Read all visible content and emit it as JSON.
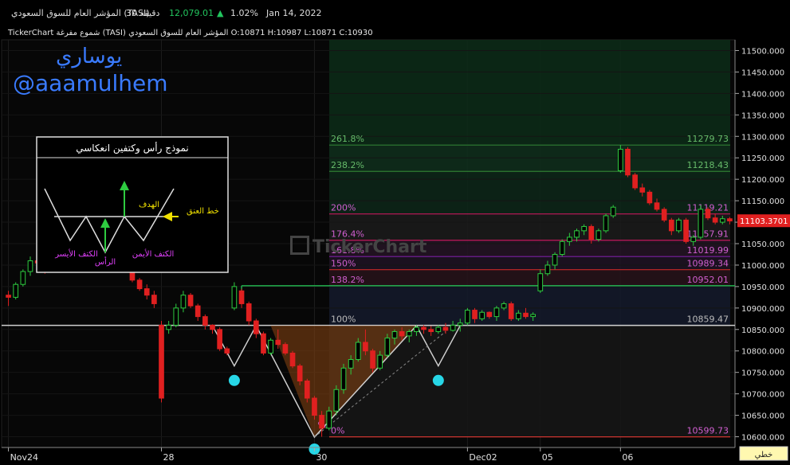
{
  "header": {
    "date": "Jan 14, 2022",
    "change_pct": "1.02%",
    "last_price": "12,079.01",
    "interval": "30 دقيقة",
    "symbol_title": "المؤشر العام للسوق السعودي (TASI)",
    "ohlc_line": "TickerChart شموع مفرغة (TASI) المؤشر العام للسوق السعودي O:10871 H:10987 L:10871 C:10930",
    "up_color": "#22c55e"
  },
  "watermark": {
    "name": "يوساري",
    "handle": "@aaamulhem",
    "brand": "TickerChart"
  },
  "pattern_box": {
    "title": "نموذج رأس وكتفين انعكاسي",
    "target": "الهدف",
    "neckline": "خط العنق",
    "left_shoulder": "الكتف الأيسر",
    "head": "الرأس",
    "right_shoulder": "الكتف الأيمن"
  },
  "bottom_right": {
    "label": "خطي"
  },
  "chart_data": {
    "type": "candlestick",
    "ylim": [
      10575,
      11525
    ],
    "y_ticks": [
      11500,
      11450,
      11400,
      11350,
      11300,
      11250,
      11200,
      11150,
      11100,
      11050,
      11000,
      10950,
      10900,
      10850,
      10800,
      10750,
      10700,
      10650,
      10600
    ],
    "y_tick_labels": [
      "11500.000",
      "11450.000",
      "11400.000",
      "11350.000",
      "11300.000",
      "11250.000",
      "11200.000",
      "11150.000",
      "11100.000",
      "11050.000",
      "11000.000",
      "10950.000",
      "10900.000",
      "10850.000",
      "10800.000",
      "10750.000",
      "10700.000",
      "10650.000",
      "10600.000"
    ],
    "x_labels": [
      {
        "label": "Nov24",
        "index": 0
      },
      {
        "label": "28",
        "index": 21
      },
      {
        "label": "30",
        "index": 42
      },
      {
        "label": "Dec02",
        "index": 63
      },
      {
        "label": "05",
        "index": 73
      },
      {
        "label": "06",
        "index": 84
      }
    ],
    "last_price_label": "11103.3701",
    "fibonacci": [
      {
        "ratio": "261.8%",
        "value": "11279.73",
        "level": 11279.73,
        "color": "#2e7d32"
      },
      {
        "ratio": "238.2%",
        "value": "11218.43",
        "level": 11218.43,
        "color": "#2e7d32"
      },
      {
        "ratio": "200%",
        "value": "11119.21",
        "level": 11119.21,
        "color": "#c2185b"
      },
      {
        "ratio": "176.4%",
        "value": "11057.91",
        "level": 11057.91,
        "color": "#c2185b"
      },
      {
        "ratio": "161.8%",
        "value": "11019.99",
        "level": 11019.99,
        "color": "#7b1fa2"
      },
      {
        "ratio": "150%",
        "value": "10989.34",
        "level": 10989.34,
        "color": "#c62828"
      },
      {
        "ratio": "138.2%",
        "value": "10952.01",
        "level": 10952.01,
        "color": "#6a5acd"
      },
      {
        "ratio": "100%",
        "value": "10859.47",
        "level": 10859.47,
        "color": "#9e9e9e"
      },
      {
        "ratio": "0%",
        "value": "10599.73",
        "level": 10599.73,
        "color": "#e53935"
      }
    ],
    "candles": [
      [
        10930,
        10940,
        10905,
        10925
      ],
      [
        10925,
        10960,
        10920,
        10955
      ],
      [
        10955,
        10990,
        10950,
        10985
      ],
      [
        10985,
        11020,
        10975,
        11010
      ],
      [
        11010,
        11000,
        10990,
        11005
      ],
      [
        11005,
        10995,
        10980,
        10990
      ],
      [
        10990,
        11030,
        10985,
        11025
      ],
      [
        11025,
        11060,
        11020,
        11055
      ],
      [
        11055,
        11080,
        11045,
        11070
      ],
      [
        11070,
        11095,
        11060,
        11090
      ],
      [
        11090,
        11100,
        11070,
        11075
      ],
      [
        11075,
        11085,
        11050,
        11060
      ],
      [
        11060,
        11070,
        11030,
        11040
      ],
      [
        11040,
        11050,
        11010,
        11020
      ],
      [
        11020,
        11035,
        11010,
        11030
      ],
      [
        11030,
        11040,
        11000,
        11010
      ],
      [
        11010,
        11015,
        10985,
        10990
      ],
      [
        10990,
        10995,
        10960,
        10965
      ],
      [
        10965,
        10970,
        10940,
        10945
      ],
      [
        10945,
        10955,
        10920,
        10930
      ],
      [
        10930,
        10940,
        10900,
        10910
      ],
      [
        10860,
        10870,
        10680,
        10690
      ],
      [
        10850,
        10870,
        10840,
        10860
      ],
      [
        10860,
        10910,
        10855,
        10900
      ],
      [
        10900,
        10940,
        10890,
        10930
      ],
      [
        10930,
        10935,
        10900,
        10905
      ],
      [
        10905,
        10910,
        10870,
        10880
      ],
      [
        10880,
        10885,
        10850,
        10860
      ],
      [
        10860,
        10862,
        10840,
        10850
      ],
      [
        10850,
        10855,
        10800,
        10805
      ],
      [
        10805,
        10810,
        10790,
        10795
      ],
      [
        10900,
        10960,
        10895,
        10950
      ],
      [
        10940,
        10945,
        10900,
        10910
      ],
      [
        10910,
        10915,
        10860,
        10870
      ],
      [
        10870,
        10875,
        10830,
        10840
      ],
      [
        10840,
        10845,
        10790,
        10795
      ],
      [
        10795,
        10830,
        10790,
        10825
      ],
      [
        10825,
        10850,
        10805,
        10815
      ],
      [
        10815,
        10820,
        10790,
        10795
      ],
      [
        10795,
        10800,
        10760,
        10765
      ],
      [
        10765,
        10770,
        10720,
        10730
      ],
      [
        10730,
        10735,
        10680,
        10690
      ],
      [
        10690,
        10695,
        10640,
        10650
      ],
      [
        10650,
        10660,
        10600,
        10620
      ],
      [
        10620,
        10670,
        10615,
        10660
      ],
      [
        10660,
        10720,
        10650,
        10710
      ],
      [
        10710,
        10770,
        10700,
        10760
      ],
      [
        10760,
        10790,
        10745,
        10780
      ],
      [
        10780,
        10830,
        10775,
        10820
      ],
      [
        10820,
        10850,
        10790,
        10800
      ],
      [
        10800,
        10805,
        10750,
        10760
      ],
      [
        10760,
        10800,
        10755,
        10790
      ],
      [
        10790,
        10840,
        10785,
        10830
      ],
      [
        10830,
        10850,
        10815,
        10845
      ],
      [
        10845,
        10855,
        10825,
        10835
      ],
      [
        10835,
        10850,
        10820,
        10845
      ],
      [
        10845,
        10860,
        10835,
        10855
      ],
      [
        10855,
        10860,
        10840,
        10850
      ],
      [
        10850,
        10858,
        10835,
        10845
      ],
      [
        10845,
        10860,
        10840,
        10855
      ],
      [
        10855,
        10865,
        10840,
        10848
      ],
      [
        10848,
        10870,
        10845,
        10860
      ],
      [
        10860,
        10875,
        10845,
        10865
      ],
      [
        10865,
        10900,
        10860,
        10895
      ],
      [
        10895,
        10900,
        10865,
        10875
      ],
      [
        10875,
        10895,
        10870,
        10890
      ],
      [
        10890,
        10892,
        10875,
        10880
      ],
      [
        10880,
        10905,
        10870,
        10900
      ],
      [
        10900,
        10915,
        10895,
        10910
      ],
      [
        10910,
        10915,
        10870,
        10875
      ],
      [
        10875,
        10895,
        10870,
        10888
      ],
      [
        10888,
        10900,
        10875,
        10880
      ],
      [
        10880,
        10890,
        10870,
        10885
      ],
      [
        10940,
        10990,
        10935,
        10980
      ],
      [
        10980,
        11010,
        10975,
        11000
      ],
      [
        11000,
        11030,
        10990,
        11025
      ],
      [
        11025,
        11060,
        11020,
        11055
      ],
      [
        11055,
        11075,
        11045,
        11065
      ],
      [
        11065,
        11085,
        11055,
        11080
      ],
      [
        11080,
        11095,
        11070,
        11090
      ],
      [
        11090,
        11095,
        11050,
        11060
      ],
      [
        11060,
        11085,
        11055,
        11080
      ],
      [
        11080,
        11120,
        11075,
        11115
      ],
      [
        11115,
        11140,
        11110,
        11135
      ],
      [
        11220,
        11280,
        11215,
        11270
      ],
      [
        11270,
        11275,
        11205,
        11210
      ],
      [
        11210,
        11215,
        11175,
        11180
      ],
      [
        11180,
        11190,
        11160,
        11170
      ],
      [
        11170,
        11175,
        11140,
        11145
      ],
      [
        11145,
        11155,
        11125,
        11130
      ],
      [
        11130,
        11135,
        11100,
        11105
      ],
      [
        11105,
        11110,
        11070,
        11080
      ],
      [
        11080,
        11110,
        11075,
        11105
      ],
      [
        11105,
        11110,
        11050,
        11055
      ],
      [
        11055,
        11070,
        11045,
        11065
      ],
      [
        11065,
        11140,
        11060,
        11130
      ],
      [
        11130,
        11135,
        11105,
        11110
      ],
      [
        11110,
        11120,
        11095,
        11100
      ],
      [
        11100,
        11115,
        11095,
        11108
      ],
      [
        11108,
        11112,
        11095,
        11103
      ]
    ]
  }
}
